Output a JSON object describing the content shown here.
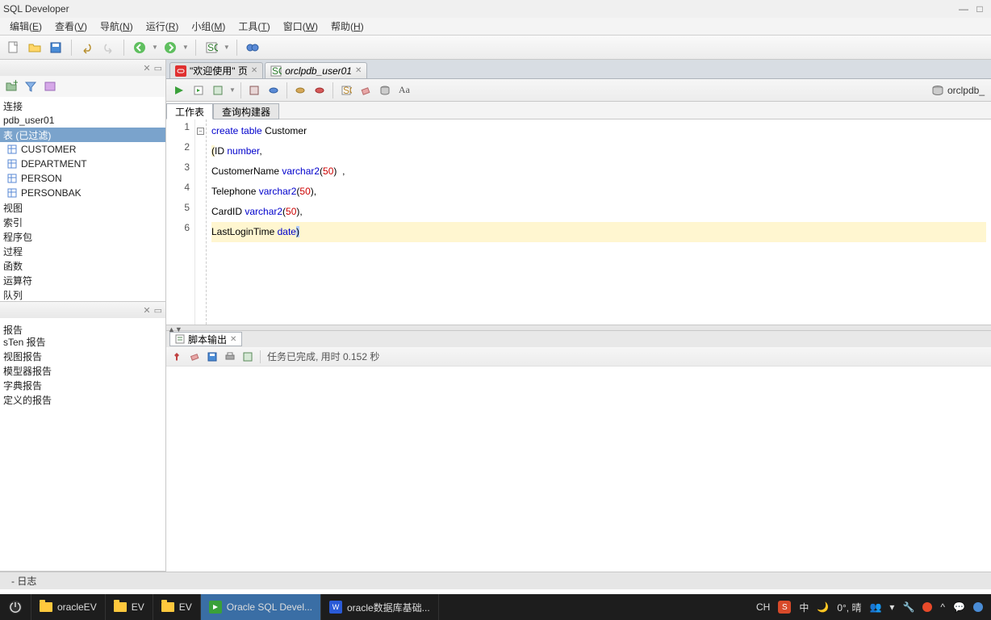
{
  "title": "SQL Developer",
  "menus": [
    {
      "label": "编辑",
      "key": "E"
    },
    {
      "label": "查看",
      "key": "V"
    },
    {
      "label": "导航",
      "key": "N"
    },
    {
      "label": "运行",
      "key": "R"
    },
    {
      "label": "小组",
      "key": "M"
    },
    {
      "label": "工具",
      "key": "T"
    },
    {
      "label": "窗口",
      "key": "W"
    },
    {
      "label": "帮助",
      "key": "H"
    }
  ],
  "connTree": {
    "header": "连接",
    "conn": "pdb_user01",
    "filtered": "表 (已过滤)",
    "tables": [
      "CUSTOMER",
      "DEPARTMENT",
      "PERSON",
      "PERSONBAK"
    ],
    "nodes": [
      "视图",
      "索引",
      "程序包",
      "过程",
      "函数",
      "运算符",
      "队列"
    ]
  },
  "reportsTree": {
    "nodes": [
      "报告",
      "sTen 报告",
      "视图报告",
      "模型器报告",
      "字典报告",
      "定义的报告"
    ]
  },
  "editorTabs": [
    {
      "label": "\"欢迎使用\" 页",
      "icon": "oracle"
    },
    {
      "label": "orclpdb_user01",
      "icon": "sql"
    }
  ],
  "subtabs": [
    "工作表",
    "查询构建器"
  ],
  "dbLabel": "orclpdb_",
  "scriptOutput": {
    "tab": "脚本输出",
    "status": "任务已完成, 用时 0.152 秒"
  },
  "code": {
    "lines": [
      [
        {
          "t": "create",
          "c": "kw"
        },
        {
          "t": " "
        },
        {
          "t": "table",
          "c": "kw"
        },
        {
          "t": " Customer"
        }
      ],
      [
        {
          "t": "(",
          "c": "hl"
        },
        {
          "t": "ID "
        },
        {
          "t": "number",
          "c": "kw"
        },
        {
          "t": ","
        }
      ],
      [
        {
          "t": "CustomerName "
        },
        {
          "t": "varchar2",
          "c": "kw"
        },
        {
          "t": "("
        },
        {
          "t": "50",
          "c": "num"
        },
        {
          "t": ")  ,"
        }
      ],
      [
        {
          "t": "Telephone "
        },
        {
          "t": "varchar2",
          "c": "kw"
        },
        {
          "t": "("
        },
        {
          "t": "50",
          "c": "num"
        },
        {
          "t": "),"
        }
      ],
      [
        {
          "t": "CardID "
        },
        {
          "t": "varchar2",
          "c": "kw"
        },
        {
          "t": "("
        },
        {
          "t": "50",
          "c": "num"
        },
        {
          "t": "),"
        }
      ],
      [
        {
          "t": "LastLoginTime "
        },
        {
          "t": "date",
          "c": "kw"
        },
        {
          "t": ")",
          "c": "curpar"
        }
      ]
    ]
  },
  "bottomTab": "- 日志",
  "taskbar": {
    "items": [
      {
        "label": "oracleEV",
        "type": "folder"
      },
      {
        "label": "EV",
        "type": "folder"
      },
      {
        "label": "EV",
        "type": "folder"
      },
      {
        "label": "Oracle SQL Devel...",
        "type": "app-oracle",
        "active": true
      },
      {
        "label": "oracle数据库基础...",
        "type": "app-wps"
      }
    ],
    "tray": {
      "ime": "CH",
      "lang": "中",
      "temp": "0°, 晴"
    }
  }
}
